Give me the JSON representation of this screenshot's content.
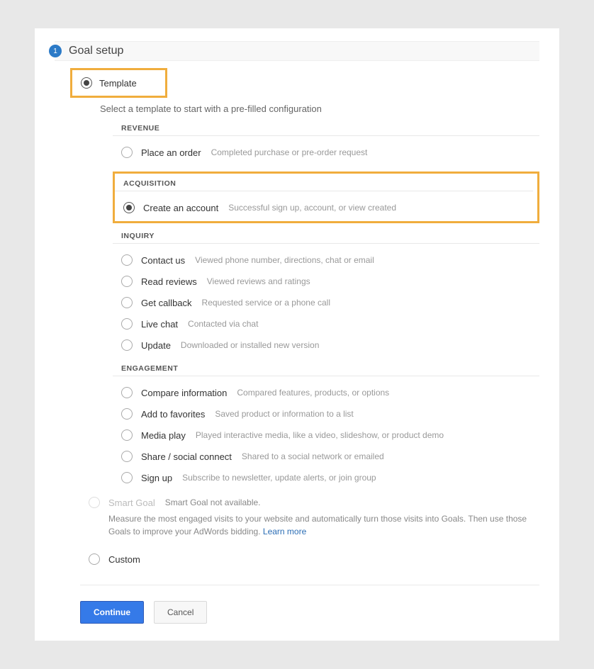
{
  "step": {
    "number": "1",
    "title": "Goal setup"
  },
  "main": {
    "template_label": "Template",
    "template_hint": "Select a template to start with a pre-filled configuration",
    "smart_goal": {
      "label": "Smart Goal",
      "status": "Smart Goal not available.",
      "description": "Measure the most engaged visits to your website and automatically turn those visits into Goals. Then use those Goals to improve your AdWords bidding. ",
      "learn_more": "Learn more"
    },
    "custom_label": "Custom"
  },
  "categories": {
    "revenue": {
      "heading": "REVENUE",
      "items": [
        {
          "label": "Place an order",
          "desc": "Completed purchase or pre-order request"
        }
      ]
    },
    "acquisition": {
      "heading": "ACQUISITION",
      "items": [
        {
          "label": "Create an account",
          "desc": "Successful sign up, account, or view created"
        }
      ]
    },
    "inquiry": {
      "heading": "INQUIRY",
      "items": [
        {
          "label": "Contact us",
          "desc": "Viewed phone number, directions, chat or email"
        },
        {
          "label": "Read reviews",
          "desc": "Viewed reviews and ratings"
        },
        {
          "label": "Get callback",
          "desc": "Requested service or a phone call"
        },
        {
          "label": "Live chat",
          "desc": "Contacted via chat"
        },
        {
          "label": "Update",
          "desc": "Downloaded or installed new version"
        }
      ]
    },
    "engagement": {
      "heading": "ENGAGEMENT",
      "items": [
        {
          "label": "Compare information",
          "desc": "Compared features, products, or options"
        },
        {
          "label": "Add to favorites",
          "desc": "Saved product or information to a list"
        },
        {
          "label": "Media play",
          "desc": "Played interactive media, like a video, slideshow, or product demo"
        },
        {
          "label": "Share / social connect",
          "desc": "Shared to a social network or emailed"
        },
        {
          "label": "Sign up",
          "desc": "Subscribe to newsletter, update alerts, or join group"
        }
      ]
    }
  },
  "buttons": {
    "continue": "Continue",
    "cancel": "Cancel"
  }
}
